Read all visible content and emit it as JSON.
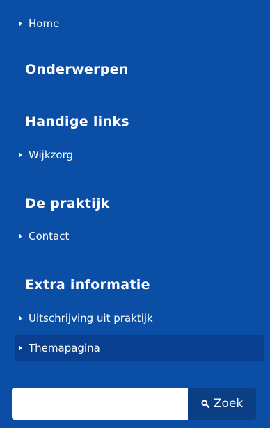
{
  "nav": {
    "home_label": "Home"
  },
  "sections": {
    "onderwerpen": {
      "heading": "Onderwerpen"
    },
    "handige_links": {
      "heading": "Handige links",
      "items": [
        "Wijkzorg"
      ]
    },
    "de_praktijk": {
      "heading": "De praktijk",
      "items": [
        "Contact"
      ]
    },
    "extra_informatie": {
      "heading": "Extra informatie",
      "items": [
        "Uitschrijving uit praktijk",
        "Themapagina"
      ]
    }
  },
  "search": {
    "value": "",
    "button_label": "Zoek",
    "button_icon": "search-icon"
  },
  "colors": {
    "background": "#0a4ea6",
    "active_item": "#083f8f",
    "search_button": "#0a3f85",
    "text": "#ffffff"
  }
}
